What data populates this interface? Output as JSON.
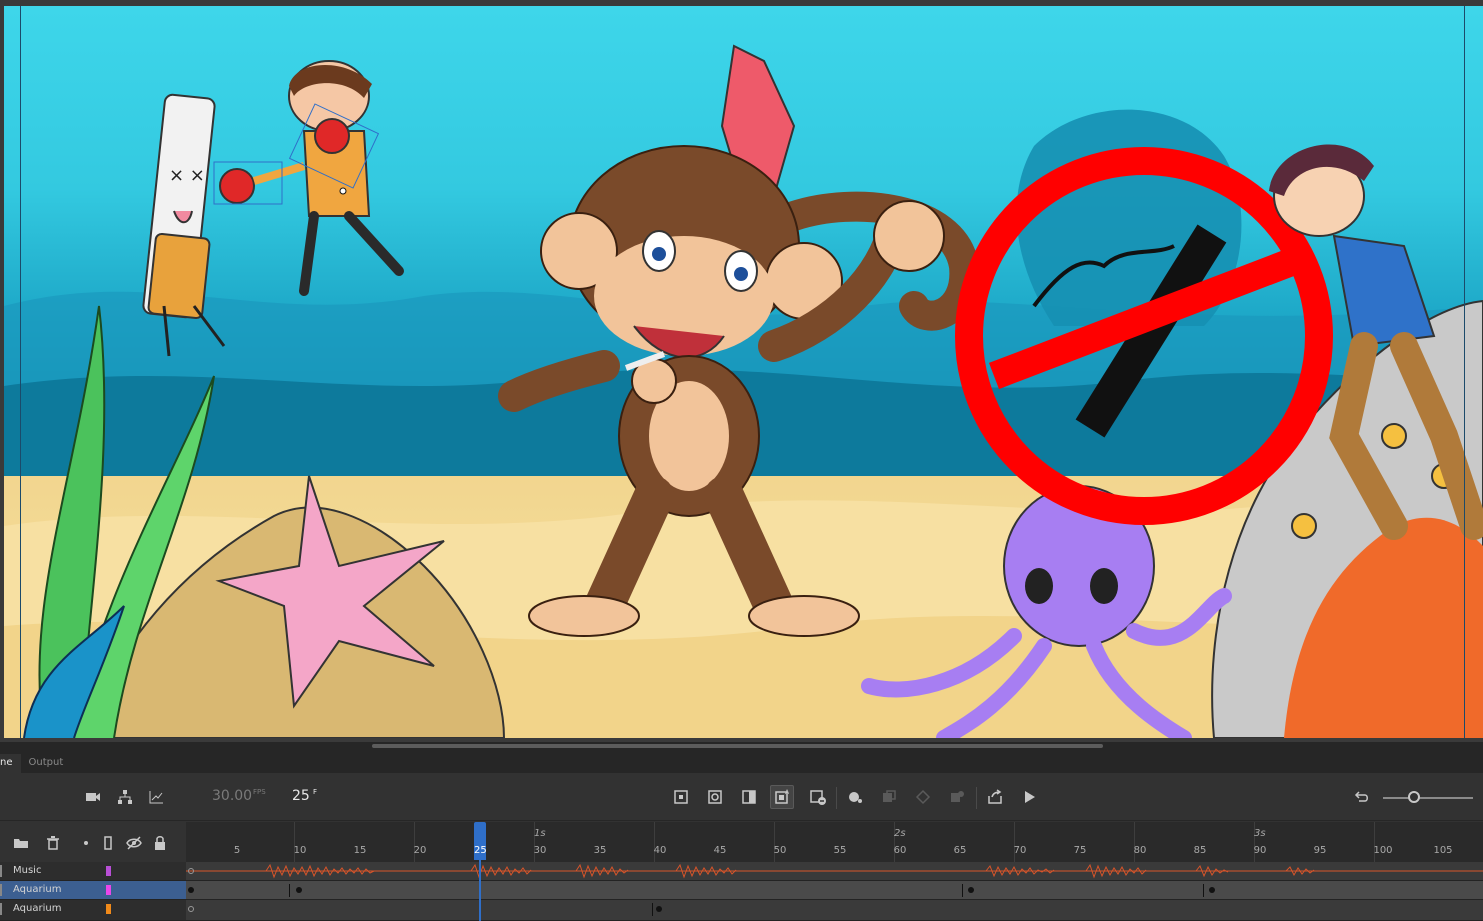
{
  "panel": {
    "tabs": [
      {
        "label": "ne"
      },
      {
        "label": "Output"
      }
    ]
  },
  "timeline": {
    "fps_value": "30.00",
    "fps_unit": "FPS",
    "current_frame": "25",
    "frame_unit": "F",
    "playhead_frame": "25",
    "frame_ticks": [
      "5",
      "10",
      "15",
      "20",
      "25",
      "30",
      "35",
      "40",
      "45",
      "50",
      "55",
      "60",
      "65",
      "70",
      "75",
      "80",
      "85",
      "90",
      "95",
      "100",
      "105"
    ],
    "second_labels": [
      "1s",
      "2s",
      "3s"
    ],
    "layers": [
      {
        "name": "Music",
        "color": "#b84fd6",
        "selected": false
      },
      {
        "name": "Aquarium",
        "color": "#ea46ea",
        "selected": true
      },
      {
        "name": "Aquarium",
        "color": "#f08a1a",
        "selected": false
      }
    ]
  },
  "colors": {
    "accent": "#2f6fc9",
    "audio_wave": "#d8552a",
    "no_sign": "#ff0000"
  }
}
